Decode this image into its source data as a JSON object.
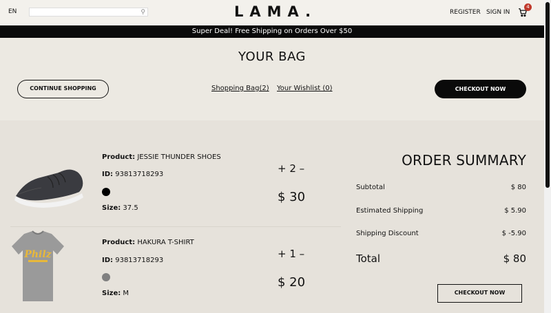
{
  "navbar": {
    "lang": "EN",
    "search_placeholder": "",
    "logo": "LAMA.",
    "register": "REGISTER",
    "sign_in": "SIGN IN",
    "cart_count": "4"
  },
  "announcement": "Super Deal! Free Shipping on Orders Over $50",
  "page_title": "YOUR BAG",
  "top": {
    "continue": "CONTINUE SHOPPING",
    "shopping_bag": "Shopping Bag(2)",
    "wishlist": "Your Wishlist (0)",
    "checkout": "CHECKOUT NOW"
  },
  "products": [
    {
      "product_label": "Product:",
      "product_name": "JESSIE THUNDER SHOES",
      "id_label": "ID:",
      "id": "93813718293",
      "color": "#000000",
      "size_label": "Size:",
      "size": "37.5",
      "qty": "+ 2 –",
      "price": "$ 30"
    },
    {
      "product_label": "Product:",
      "product_name": "HAKURA T-SHIRT",
      "id_label": "ID:",
      "id": "93813718293",
      "color": "#808080",
      "size_label": "Size:",
      "size": "M",
      "qty": "+ 1 –",
      "price": "$ 20"
    }
  ],
  "summary": {
    "title": "ORDER SUMMARY",
    "subtotal_label": "Subtotal",
    "subtotal": "$ 80",
    "shipping_label": "Estimated Shipping",
    "shipping": "$ 5.90",
    "discount_label": "Shipping Discount",
    "discount": "$ -5.90",
    "total_label": "Total",
    "total": "$ 80",
    "checkout": "CHECKOUT NOW"
  },
  "colors": {
    "background": "#ece9e2",
    "announcement_bg": "#0a0a0a",
    "badge": "#c0392b"
  }
}
